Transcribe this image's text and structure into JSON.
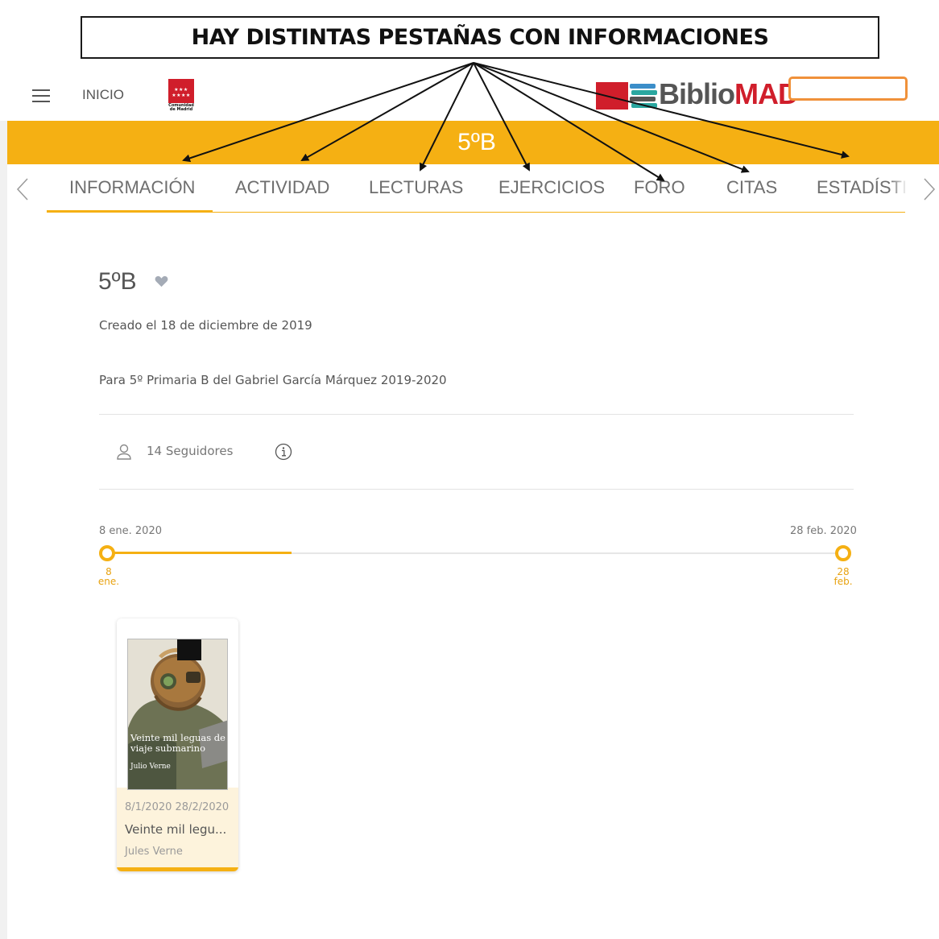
{
  "annotation": {
    "text": "HAY DISTINTAS PESTAÑAS CON INFORMACIONES"
  },
  "header": {
    "menu_icon": "hamburger-menu-icon",
    "home_label": "INICIO",
    "comunidad_logo_text": "Comunidad de Madrid",
    "brand_logo": {
      "part1": "Biblio",
      "part2": "MAD"
    }
  },
  "banner": {
    "title": "5ºB",
    "color": "#f5b013"
  },
  "tabs": [
    {
      "label": "INFORMACIÓN",
      "active": true
    },
    {
      "label": "ACTIVIDAD"
    },
    {
      "label": "LECTURAS"
    },
    {
      "label": "EJERCICIOS"
    },
    {
      "label": "FORO"
    },
    {
      "label": "CITAS"
    },
    {
      "label": "ESTADÍSTIC"
    }
  ],
  "group": {
    "title": "5ºB",
    "created": "Creado el 18 de diciembre de 2019",
    "description": "Para 5º Primaria B del Gabriel García Márquez 2019-2020",
    "followers": "14 Seguidores"
  },
  "timeline": {
    "start_date": "8 ene. 2020",
    "end_date": "28 feb. 2020",
    "start_day": "8",
    "start_month": "ene.",
    "end_day": "28",
    "end_month": "feb.",
    "progress": 0.25
  },
  "book": {
    "cover_title": "Veinte mil leguas de viaje submarino",
    "cover_author": "Julio Verne",
    "dates": "8/1/2020 28/2/2020",
    "title": "Veinte mil legu...",
    "author": "Jules Verne"
  }
}
